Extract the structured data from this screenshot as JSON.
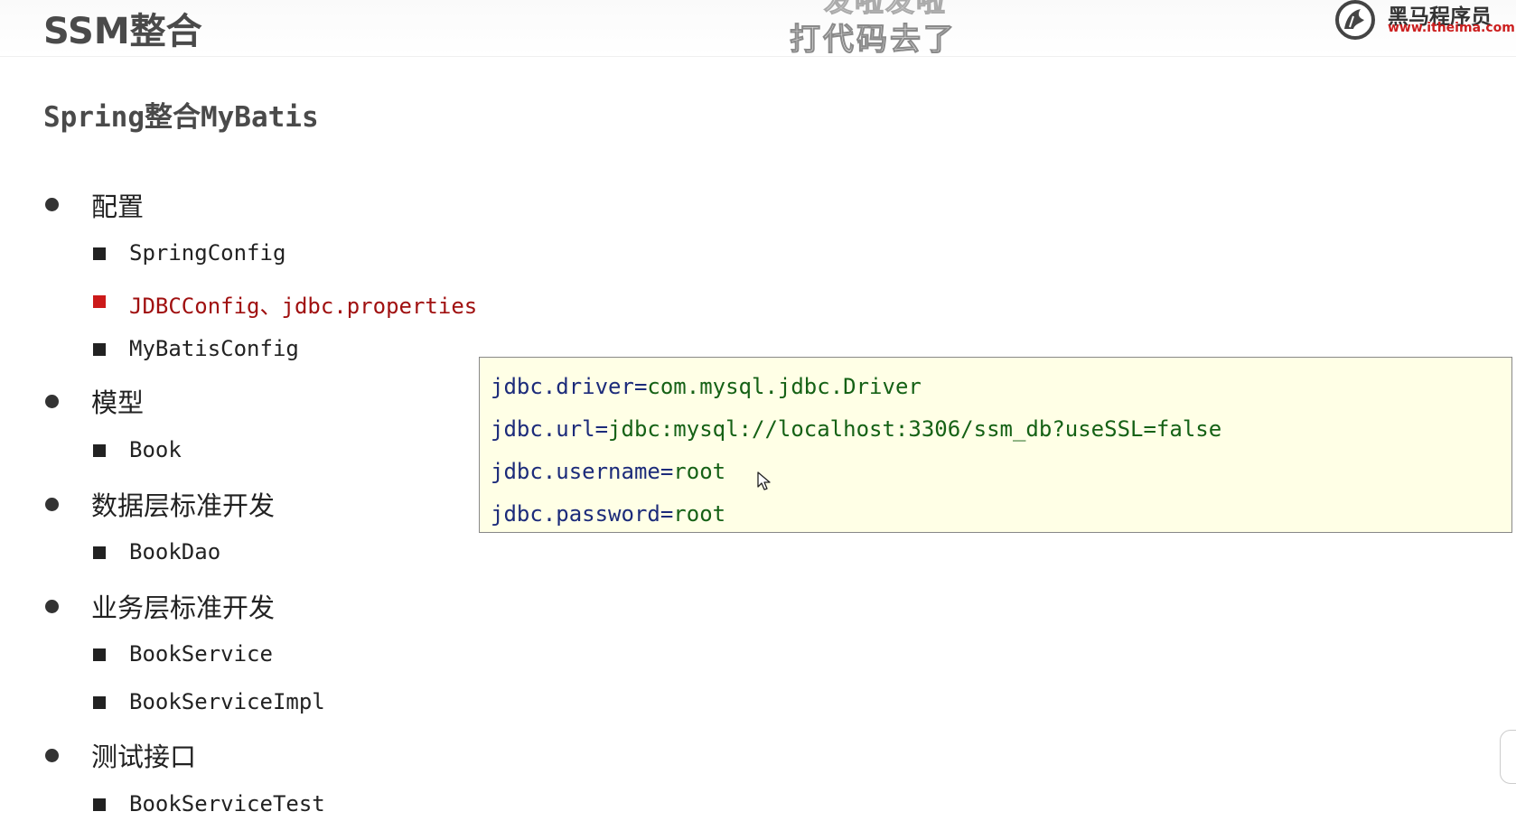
{
  "header": {
    "title": "SSM整合",
    "caption_partial": "发啦发啦",
    "caption": "打代码去了",
    "brand_icon": "horse-logo-icon",
    "brand_name": "黑马程序员",
    "brand_url": "www.itheima.com"
  },
  "section_title": "Spring整合MyBatis",
  "outline": [
    {
      "label": "配置",
      "children": [
        {
          "label": "SpringConfig",
          "highlight": false
        },
        {
          "label": "JDBCConfig、jdbc.properties",
          "highlight": true
        },
        {
          "label": "MyBatisConfig",
          "highlight": false
        }
      ]
    },
    {
      "label": "模型",
      "children": [
        {
          "label": "Book",
          "highlight": false
        }
      ]
    },
    {
      "label": "数据层标准开发",
      "children": [
        {
          "label": "BookDao",
          "highlight": false
        }
      ]
    },
    {
      "label": "业务层标准开发",
      "children": [
        {
          "label": "BookService",
          "highlight": false
        },
        {
          "label": "BookServiceImpl",
          "highlight": false
        }
      ]
    },
    {
      "label": "测试接口",
      "children": [
        {
          "label": "BookServiceTest",
          "highlight": false
        }
      ]
    }
  ],
  "code_box": {
    "lines": [
      {
        "key": "jdbc.driver",
        "value": "com.mysql.jdbc.Driver"
      },
      {
        "key": "jdbc.url",
        "value": "jdbc:mysql://localhost:3306/ssm_db?useSSL=false"
      },
      {
        "key": "jdbc.username",
        "value": "root"
      },
      {
        "key": "jdbc.password",
        "value": "root"
      }
    ]
  },
  "icons": {
    "cursor": "mouse-pointer-icon",
    "bullet_level1": "filled-circle-icon",
    "bullet_level2": "filled-square-icon"
  },
  "colors": {
    "highlight": "#a01010",
    "highlight_bullet": "#cc1a1a",
    "code_background": "#ffffe6",
    "code_key": "#1c2b7a",
    "code_value": "#156115"
  }
}
